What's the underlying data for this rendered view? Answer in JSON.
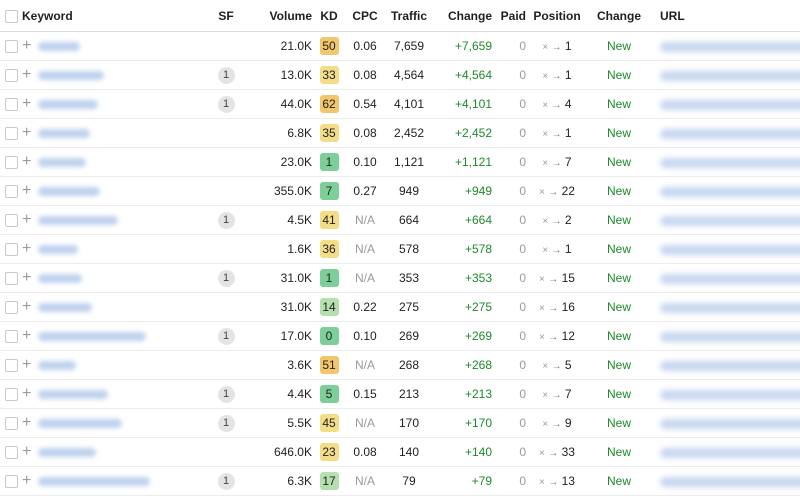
{
  "columns": {
    "keyword": "Keyword",
    "sf": "SF",
    "volume": "Volume",
    "kd": "KD",
    "cpc": "CPC",
    "traffic": "Traffic",
    "change": "Change",
    "paid": "Paid",
    "position": "Position",
    "pos_change": "Change",
    "url": "URL"
  },
  "position_arrow_glyph": "→",
  "position_prev_glyph": "×",
  "rows": [
    {
      "sf": "",
      "volume": "21.0K",
      "kd": "50",
      "kd_color": "#f2c66b",
      "cpc": "0.06",
      "traffic": "7,659",
      "change": "+7,659",
      "paid": "0",
      "pos": "1",
      "status": "New"
    },
    {
      "sf": "1",
      "volume": "13.0K",
      "kd": "33",
      "kd_color": "#f4dd87",
      "cpc": "0.08",
      "traffic": "4,564",
      "change": "+4,564",
      "paid": "0",
      "pos": "1",
      "status": "New"
    },
    {
      "sf": "1",
      "volume": "44.0K",
      "kd": "62",
      "kd_color": "#f2c66b",
      "cpc": "0.54",
      "traffic": "4,101",
      "change": "+4,101",
      "paid": "0",
      "pos": "4",
      "status": "New"
    },
    {
      "sf": "",
      "volume": "6.8K",
      "kd": "35",
      "kd_color": "#f4dd87",
      "cpc": "0.08",
      "traffic": "2,452",
      "change": "+2,452",
      "paid": "0",
      "pos": "1",
      "status": "New"
    },
    {
      "sf": "",
      "volume": "23.0K",
      "kd": "1",
      "kd_color": "#7dcf9a",
      "cpc": "0.10",
      "traffic": "1,121",
      "change": "+1,121",
      "paid": "0",
      "pos": "7",
      "status": "New"
    },
    {
      "sf": "",
      "volume": "355.0K",
      "kd": "7",
      "kd_color": "#7dcf9a",
      "cpc": "0.27",
      "traffic": "949",
      "change": "+949",
      "paid": "0",
      "pos": "22",
      "status": "New"
    },
    {
      "sf": "1",
      "volume": "4.5K",
      "kd": "41",
      "kd_color": "#f4dd87",
      "cpc": "N/A",
      "traffic": "664",
      "change": "+664",
      "paid": "0",
      "pos": "2",
      "status": "New"
    },
    {
      "sf": "",
      "volume": "1.6K",
      "kd": "36",
      "kd_color": "#f4dd87",
      "cpc": "N/A",
      "traffic": "578",
      "change": "+578",
      "paid": "0",
      "pos": "1",
      "status": "New"
    },
    {
      "sf": "1",
      "volume": "31.0K",
      "kd": "1",
      "kd_color": "#7dcf9a",
      "cpc": "N/A",
      "traffic": "353",
      "change": "+353",
      "paid": "0",
      "pos": "15",
      "status": "New"
    },
    {
      "sf": "",
      "volume": "31.0K",
      "kd": "14",
      "kd_color": "#b6dfb0",
      "cpc": "0.22",
      "traffic": "275",
      "change": "+275",
      "paid": "0",
      "pos": "16",
      "status": "New"
    },
    {
      "sf": "1",
      "volume": "17.0K",
      "kd": "0",
      "kd_color": "#7dcf9a",
      "cpc": "0.10",
      "traffic": "269",
      "change": "+269",
      "paid": "0",
      "pos": "12",
      "status": "New"
    },
    {
      "sf": "",
      "volume": "3.6K",
      "kd": "51",
      "kd_color": "#f2c66b",
      "cpc": "N/A",
      "traffic": "268",
      "change": "+268",
      "paid": "0",
      "pos": "5",
      "status": "New"
    },
    {
      "sf": "1",
      "volume": "4.4K",
      "kd": "5",
      "kd_color": "#7dcf9a",
      "cpc": "0.15",
      "traffic": "213",
      "change": "+213",
      "paid": "0",
      "pos": "7",
      "status": "New"
    },
    {
      "sf": "1",
      "volume": "5.5K",
      "kd": "45",
      "kd_color": "#f4dd87",
      "cpc": "N/A",
      "traffic": "170",
      "change": "+170",
      "paid": "0",
      "pos": "9",
      "status": "New"
    },
    {
      "sf": "",
      "volume": "646.0K",
      "kd": "23",
      "kd_color": "#f4dd87",
      "cpc": "0.08",
      "traffic": "140",
      "change": "+140",
      "paid": "0",
      "pos": "33",
      "status": "New"
    },
    {
      "sf": "1",
      "volume": "6.3K",
      "kd": "17",
      "kd_color": "#b6dfb0",
      "cpc": "N/A",
      "traffic": "79",
      "change": "+79",
      "paid": "0",
      "pos": "13",
      "status": "New"
    }
  ],
  "colors": {
    "change_positive": "#1d8a2b",
    "status_new": "#1d8a2b",
    "muted": "#9a9a9a"
  }
}
